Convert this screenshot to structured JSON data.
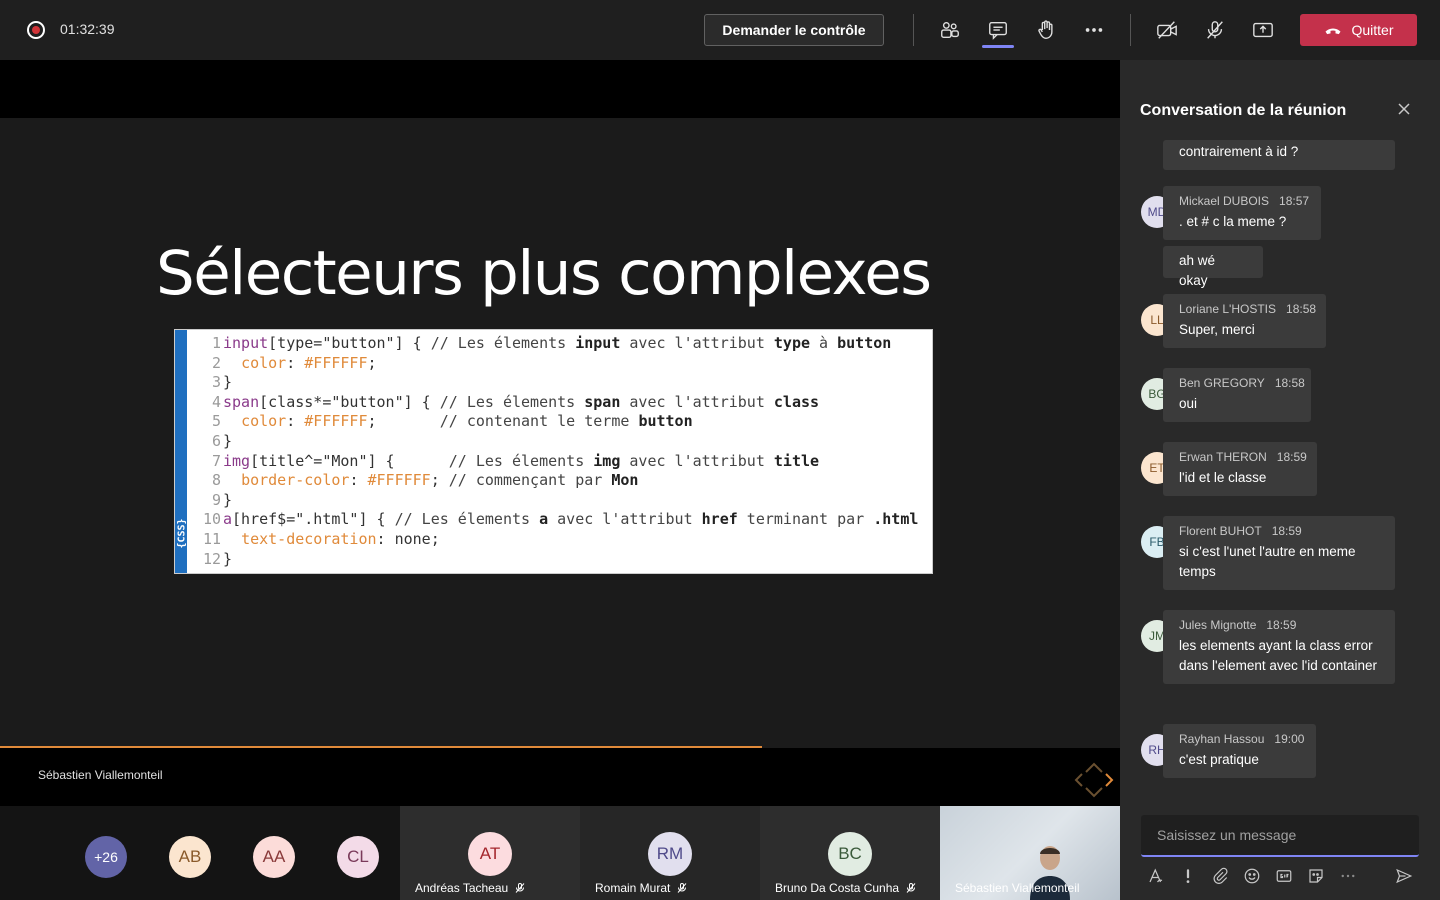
{
  "topbar": {
    "timer": "01:32:39",
    "request_control_label": "Demander le contrôle",
    "quit_label": "Quitter",
    "accent": "#c4314b"
  },
  "slide": {
    "title": "Sélecteurs plus complexes",
    "code_tag": "{CSS}",
    "code_lines": [
      {
        "n": "1",
        "text": "input[type=\"button\"] { // Les élements input avec l'attribut type à button"
      },
      {
        "n": "2",
        "text": "  color: #FFFFFF;"
      },
      {
        "n": "3",
        "text": "}"
      },
      {
        "n": "4",
        "text": "span[class*=\"button\"] { // Les élements span avec l'attribut class"
      },
      {
        "n": "5",
        "text": "  color: #FFFFFF;       // contenant le terme button"
      },
      {
        "n": "6",
        "text": "}"
      },
      {
        "n": "7",
        "text": "img[title^=\"Mon\"] {      // Les élements img avec l'attribut title"
      },
      {
        "n": "8",
        "text": "  border-color: #FFFFFF; // commençant par Mon"
      },
      {
        "n": "9",
        "text": "}"
      },
      {
        "n": "10",
        "text": "a[href$=\".html\"] { // Les élements a avec l'attribut href terminant par .html"
      },
      {
        "n": "11",
        "text": "  text-decoration: none;"
      },
      {
        "n": "12",
        "text": "}"
      }
    ],
    "progress": 0.68,
    "presenter": "Sébastien Viallemonteil"
  },
  "participants": {
    "overflow": "+26",
    "small": [
      "AB",
      "AA",
      "CL"
    ],
    "tiles": [
      {
        "initials": "AT",
        "name": "Andréas Tacheau"
      },
      {
        "initials": "RM",
        "name": "Romain Murat"
      },
      {
        "initials": "BC",
        "name": "Bruno Da Costa Cunha"
      },
      {
        "initials": "",
        "name": "Sébastien Viallemonteil"
      }
    ]
  },
  "chat": {
    "title": "Conversation de la réunion",
    "messages": [
      {
        "initials": "",
        "author": "",
        "time": "",
        "text": "contrairement à id ?"
      },
      {
        "initials": "MD",
        "author": "Mickael DUBOIS",
        "time": "18:57",
        "text": ". et # c la meme ?"
      },
      {
        "initials": "",
        "author": "",
        "time": "",
        "text": "ah wé okay"
      },
      {
        "initials": "LL",
        "author": "Loriane L'HOSTIS",
        "time": "18:58",
        "text": "Super, merci"
      },
      {
        "initials": "BG",
        "author": "Ben GREGORY",
        "time": "18:58",
        "text": "oui"
      },
      {
        "initials": "ET",
        "author": "Erwan THERON",
        "time": "18:59",
        "text": "l'id et le classe"
      },
      {
        "initials": "FB",
        "author": "Florent BUHOT",
        "time": "18:59",
        "text": "si c'est l'unet l'autre en meme temps"
      },
      {
        "initials": "JM",
        "author": "Jules Mignotte",
        "time": "18:59",
        "text": "les elements ayant la class error dans l'element avec l'id container"
      },
      {
        "initials": "RH",
        "author": "Rayhan Hassou",
        "time": "19:00",
        "text": "c'est pratique"
      }
    ],
    "compose_placeholder": "Saisissez un message"
  }
}
